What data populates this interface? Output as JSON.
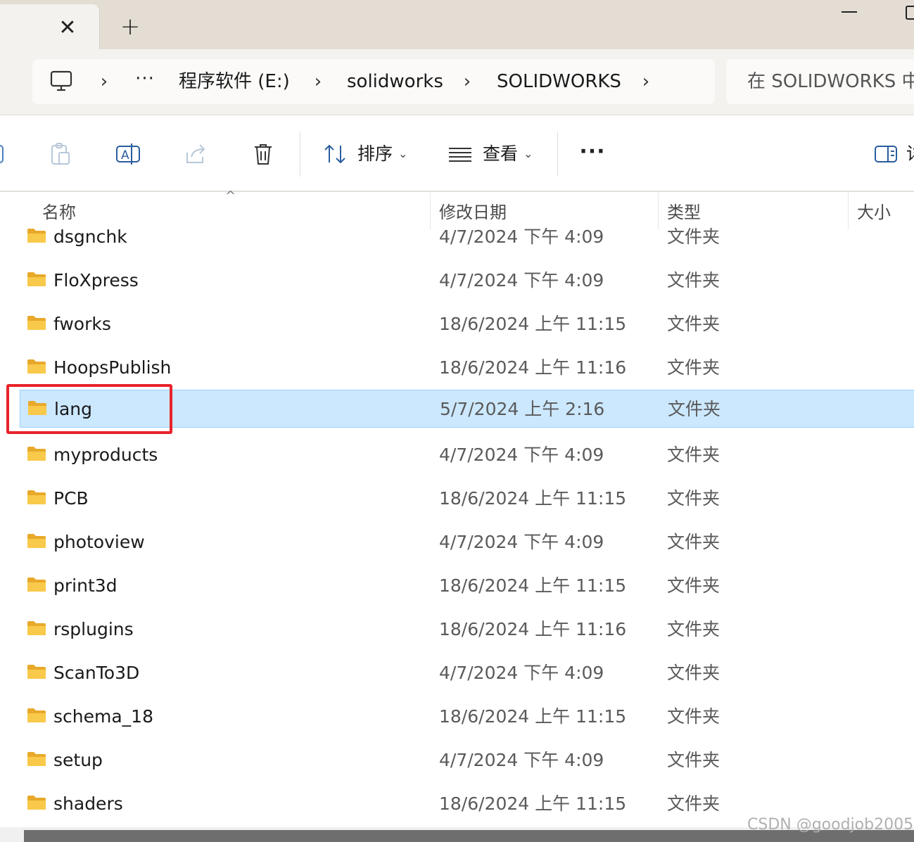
{
  "window": {
    "tab_close": "✕",
    "new_tab": "+"
  },
  "address": {
    "more": "···",
    "crumbs": [
      "程序软件 (E:)",
      "solidworks",
      "SOLIDWORKS"
    ],
    "search_placeholder": "在 SOLIDWORKS 中"
  },
  "toolbar": {
    "sort_label": "排序",
    "view_label": "查看",
    "more": "···",
    "details_label": "详",
    "caret": "⌄"
  },
  "columns": {
    "name": "名称",
    "modified": "修改日期",
    "type": "类型",
    "size": "大小"
  },
  "files": [
    {
      "name": "dsgnchk",
      "modified": "4/7/2024 下午 4:09",
      "type": "文件夹",
      "selected": false
    },
    {
      "name": "FloXpress",
      "modified": "4/7/2024 下午 4:09",
      "type": "文件夹",
      "selected": false
    },
    {
      "name": "fworks",
      "modified": "18/6/2024 上午 11:15",
      "type": "文件夹",
      "selected": false
    },
    {
      "name": "HoopsPublish",
      "modified": "18/6/2024 上午 11:16",
      "type": "文件夹",
      "selected": false
    },
    {
      "name": "lang",
      "modified": "5/7/2024 上午 2:16",
      "type": "文件夹",
      "selected": true
    },
    {
      "name": "myproducts",
      "modified": "4/7/2024 下午 4:09",
      "type": "文件夹",
      "selected": false
    },
    {
      "name": "PCB",
      "modified": "18/6/2024 上午 11:15",
      "type": "文件夹",
      "selected": false
    },
    {
      "name": "photoview",
      "modified": "4/7/2024 下午 4:09",
      "type": "文件夹",
      "selected": false
    },
    {
      "name": "print3d",
      "modified": "18/6/2024 上午 11:15",
      "type": "文件夹",
      "selected": false
    },
    {
      "name": "rsplugins",
      "modified": "18/6/2024 上午 11:16",
      "type": "文件夹",
      "selected": false
    },
    {
      "name": "ScanTo3D",
      "modified": "4/7/2024 下午 4:09",
      "type": "文件夹",
      "selected": false
    },
    {
      "name": "schema_18",
      "modified": "18/6/2024 上午 11:15",
      "type": "文件夹",
      "selected": false
    },
    {
      "name": "setup",
      "modified": "4/7/2024 下午 4:09",
      "type": "文件夹",
      "selected": false
    },
    {
      "name": "shaders",
      "modified": "18/6/2024 上午 11:15",
      "type": "文件夹",
      "selected": false
    }
  ],
  "watermark": "CSDN @goodjob2005",
  "colors": {
    "selection": "#cce8ff",
    "highlight": "#e8232b",
    "folder": "#f8c94a"
  }
}
